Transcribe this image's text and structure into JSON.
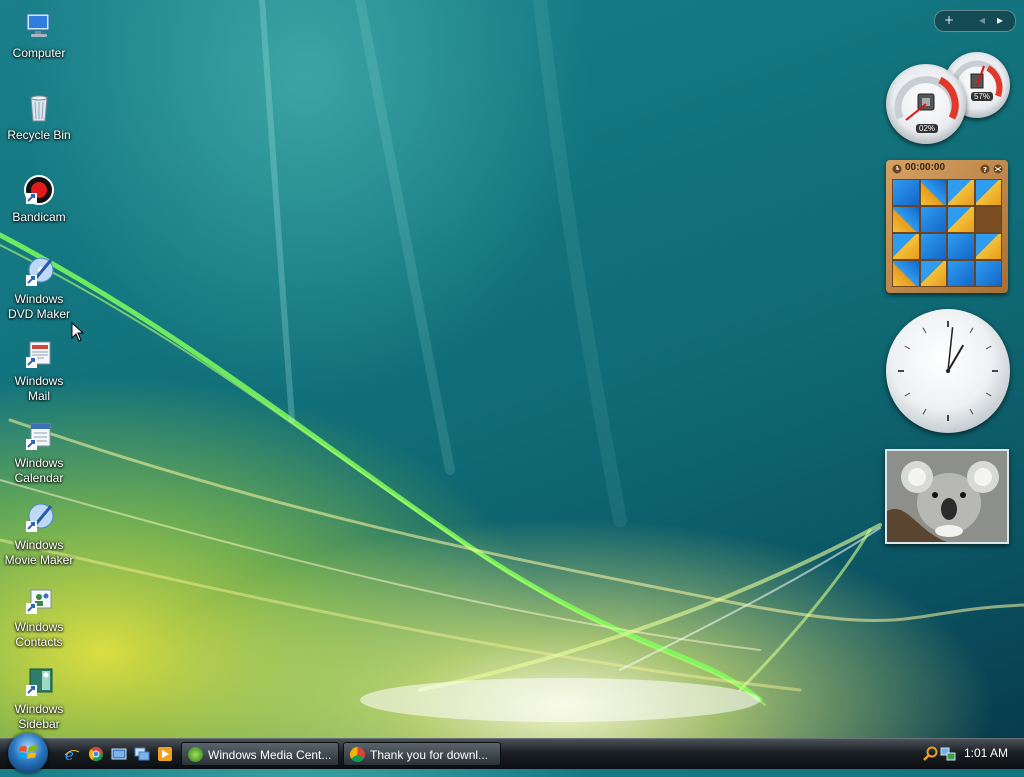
{
  "desktop": {
    "icons": [
      {
        "label": "Computer"
      },
      {
        "label": "Recycle Bin"
      },
      {
        "label": "Bandicam"
      },
      {
        "label": "Windows\nDVD Maker"
      },
      {
        "label": "Windows\nMail"
      },
      {
        "label": "Windows\nCalendar"
      },
      {
        "label": "Windows\nMovie Maker"
      },
      {
        "label": "Windows\nContacts"
      },
      {
        "label": "Windows\nSidebar"
      }
    ]
  },
  "sidebar": {
    "add_label": "+",
    "prev_label": "◂",
    "next_label": "▸",
    "cpu_meter": {
      "cpu_percent": "02%",
      "memory_percent": "57%"
    },
    "puzzle": {
      "timer": "00:00:00"
    },
    "clock": {
      "hour": 1,
      "minute": 1
    },
    "slideshow": {}
  },
  "taskbar": {
    "tasks": [
      {
        "label": "Windows Media Cent..."
      },
      {
        "label": "Thank you for downl..."
      }
    ],
    "clock": "1:01 AM"
  },
  "colors": {
    "accent": "#1a7f8a",
    "taskbar": "#1b2024",
    "start_orb": "#2a77c0"
  }
}
